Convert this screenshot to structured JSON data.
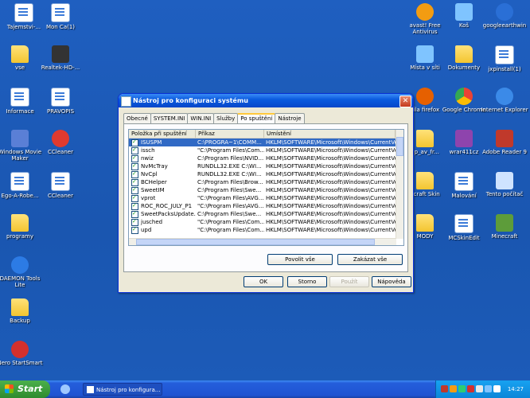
{
  "desktop_icons": [
    {
      "id": "tajemstvi",
      "label": "Tajemstvi-...",
      "color": "#ffffff"
    },
    {
      "id": "mon-ca",
      "label": "Mon   Ca(1)",
      "color": "#ffffff"
    },
    {
      "id": "vse",
      "label": "vse",
      "color": "#f3c530"
    },
    {
      "id": "realtek",
      "label": "Realtek-HD-...",
      "color": "#c0392b"
    },
    {
      "id": "informace",
      "label": "Informace",
      "color": "#ffffff"
    },
    {
      "id": "pravopis",
      "label": "PRAVOPIS",
      "color": "#ffffff"
    },
    {
      "id": "wmm",
      "label": "Windows Movie Maker",
      "color": "#5a7fd6"
    },
    {
      "id": "ccleaner1",
      "label": "CCleaner",
      "color": "#e03a2f"
    },
    {
      "id": "egoarobe",
      "label": "Ego-A-Robe...",
      "color": "#ffffff"
    },
    {
      "id": "ccleaner2",
      "label": "CCleaner",
      "color": "#ffffff"
    },
    {
      "id": "programy",
      "label": "programy",
      "color": "#f3c530"
    },
    {
      "id": "daemon",
      "label": "DAEMON Tools Lite",
      "color": "#2c7be5"
    },
    {
      "id": "backup",
      "label": "Backup",
      "color": "#f3c530"
    },
    {
      "id": "nero",
      "label": "Nero StartSmart",
      "color": "#d3302d"
    },
    {
      "id": "avast",
      "label": "avast! Free Antivirus",
      "color": "#f39c12"
    },
    {
      "id": "kos",
      "label": "Koš",
      "color": "#7fc4ff"
    },
    {
      "id": "googleearth",
      "label": "googleearthwin",
      "color": "#2a6fd6"
    },
    {
      "id": "mista",
      "label": "Místa v síti",
      "color": "#7fc4ff"
    },
    {
      "id": "dokumenty",
      "label": "Dokumenty",
      "color": "#f3c530"
    },
    {
      "id": "jxpinstall",
      "label": "jxpinstall(1)",
      "color": "#ffffff"
    },
    {
      "id": "firefox",
      "label": "zila firefox",
      "color": "#e66000"
    },
    {
      "id": "chrome",
      "label": "Google Chrome",
      "color": "#34a853"
    },
    {
      "id": "ie",
      "label": "Internet Explorer",
      "color": "#3b8ae8"
    },
    {
      "id": "upav",
      "label": "up_av_fr...",
      "color": "#f3c530"
    },
    {
      "id": "wrar",
      "label": "wrar411cz",
      "color": "#8e44ad"
    },
    {
      "id": "adobereader",
      "label": "Adobe Reader 9",
      "color": "#c0392b"
    },
    {
      "id": "mcskin",
      "label": "ecraft Skin",
      "color": "#f3c530"
    },
    {
      "id": "malovani",
      "label": "Malování",
      "color": "#ffffff"
    },
    {
      "id": "tentopc",
      "label": "Tento počítač",
      "color": "#cfe3ff"
    },
    {
      "id": "mody",
      "label": "MODY",
      "color": "#f3c530"
    },
    {
      "id": "mcskinedit",
      "label": "MCSkinEdit",
      "color": "#ffffff"
    },
    {
      "id": "minecraft",
      "label": "Minecraft",
      "color": "#5d9c3a"
    }
  ],
  "window": {
    "title": "Nástroj pro konfiguraci systému",
    "close_glyph": "✕",
    "tabs": [
      "Obecné",
      "SYSTEM.INI",
      "WIN.INI",
      "Služby",
      "Po spuštění",
      "Nástroje"
    ],
    "active_tab": "Po spuštění",
    "columns": [
      "Položka při spuštění",
      "Příkaz",
      "Umístění"
    ],
    "rows": [
      {
        "name": "ISUSPM",
        "command": "C:\\PROGRA~1\\COMM...",
        "location": "HKLM\\SOFTWARE\\Microsoft\\Windows\\CurrentVer...",
        "checked": true,
        "selected": true
      },
      {
        "name": "issch",
        "command": "\"C:\\Program Files\\Com...",
        "location": "HKLM\\SOFTWARE\\Microsoft\\Windows\\CurrentVer...",
        "checked": true
      },
      {
        "name": "nwiz",
        "command": "C:\\Program Files\\NVID...",
        "location": "HKLM\\SOFTWARE\\Microsoft\\Windows\\CurrentVer...",
        "checked": true
      },
      {
        "name": "NvMcTray",
        "command": "RUNDLL32.EXE C:\\WI...",
        "location": "HKLM\\SOFTWARE\\Microsoft\\Windows\\CurrentVer...",
        "checked": true
      },
      {
        "name": "NvCpl",
        "command": "RUNDLL32.EXE C:\\WI...",
        "location": "HKLM\\SOFTWARE\\Microsoft\\Windows\\CurrentVer...",
        "checked": true
      },
      {
        "name": "BCHelper",
        "command": "C:\\Program Files\\Brow...",
        "location": "HKLM\\SOFTWARE\\Microsoft\\Windows\\CurrentVer...",
        "checked": true
      },
      {
        "name": "SweetIM",
        "command": "C:\\Program Files\\Swe...",
        "location": "HKLM\\SOFTWARE\\Microsoft\\Windows\\CurrentVer...",
        "checked": true
      },
      {
        "name": "vprot",
        "command": "\"C:\\Program Files\\AVG...",
        "location": "HKLM\\SOFTWARE\\Microsoft\\Windows\\CurrentVer...",
        "checked": true
      },
      {
        "name": "ROC_ROC_JULY_P1",
        "command": "\"C:\\Program Files\\AVG...",
        "location": "HKLM\\SOFTWARE\\Microsoft\\Windows\\CurrentVer...",
        "checked": true
      },
      {
        "name": "SweetPacksUpdate...",
        "command": "C:\\Program Files\\Swe...",
        "location": "HKLM\\SOFTWARE\\Microsoft\\Windows\\CurrentVer...",
        "checked": true
      },
      {
        "name": "jusched",
        "command": "\"C:\\Program Files\\Com...",
        "location": "HKLM\\SOFTWARE\\Microsoft\\Windows\\CurrentVer...",
        "checked": true
      },
      {
        "name": "upd",
        "command": "\"C:\\Program Files\\Com...",
        "location": "HKLM\\SOFTWARE\\Microsoft\\Windows\\CurrentVer...",
        "checked": true
      }
    ],
    "enable_all": "Povolit vše",
    "disable_all": "Zakázat vše",
    "ok": "OK",
    "cancel": "Storno",
    "apply": "Použít",
    "help": "Nápověda"
  },
  "taskbar": {
    "start": "Start",
    "task_label": "Nástroj pro konfigura...",
    "clock": "14:27"
  }
}
